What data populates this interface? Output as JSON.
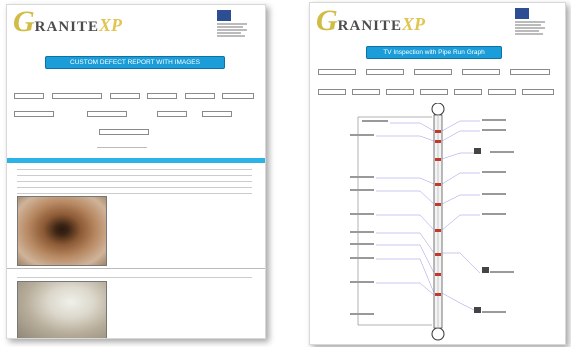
{
  "left_doc": {
    "logo": {
      "letter": "G",
      "rest": "RANITE",
      "suffix": "XP"
    },
    "banner": "CUSTOM DEFECT REPORT WITH IMAGES"
  },
  "right_doc": {
    "logo": {
      "letter": "G",
      "rest": "RANITE",
      "suffix": "XP"
    },
    "banner": "TV Inspection with Pipe Run Graph"
  },
  "icons": {
    "company_logo": "company-logo-icon"
  },
  "colors": {
    "accent": "#1a9dd9",
    "logo_gold": "#d1bc45",
    "pipe_red": "#c0392b"
  }
}
